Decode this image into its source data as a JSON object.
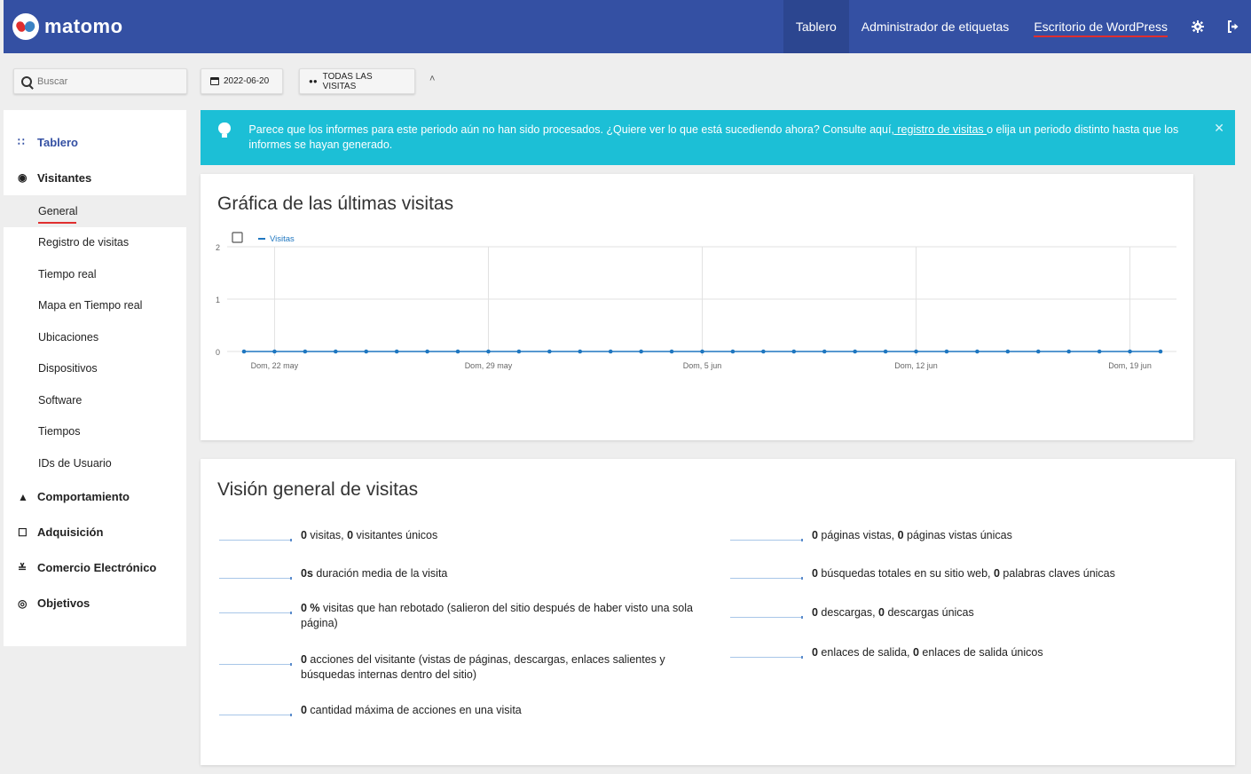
{
  "brand": {
    "name": "matomo"
  },
  "topnav": {
    "items": [
      "Tablero",
      "Administrador de etiquetas",
      "Escritorio de WordPress"
    ],
    "settings_icon": "gear-icon",
    "logout_icon": "sign-out-icon"
  },
  "search": {
    "placeholder": "Buscar"
  },
  "controls": {
    "date": "2022-06-20",
    "segment": "TODAS LAS VISITAS"
  },
  "sidebar": {
    "tablero": "Tablero",
    "visitantes": "Visitantes",
    "visitantes_items": [
      "General",
      "Registro de visitas",
      "Tiempo real",
      "Mapa en Tiempo real",
      "Ubicaciones",
      "Dispositivos",
      "Software",
      "Tiempos",
      "IDs de Usuario"
    ],
    "comportamiento": "Comportamiento",
    "adquisicion": "Adquisición",
    "comercio": "Comercio Electrónico",
    "objetivos": "Objetivos"
  },
  "banner": {
    "text_before": "Parece que los informes para este periodo aún no han sido procesados. ¿Quiere ver lo que está sucediendo ahora? Consulte aquí",
    "link": ", registro de visitas ",
    "text_after": "o elija un periodo distinto hasta que los informes se hayan generado."
  },
  "chart_card": {
    "title": "Gráfica de las últimas visitas"
  },
  "chart_data": {
    "type": "line",
    "title": "Gráfica de las últimas visitas",
    "series": [
      {
        "name": "Visitas",
        "values": [
          0,
          0,
          0,
          0,
          0,
          0,
          0,
          0,
          0,
          0,
          0,
          0,
          0,
          0,
          0,
          0,
          0,
          0,
          0,
          0,
          0,
          0,
          0,
          0,
          0,
          0,
          0,
          0,
          0,
          0,
          0
        ]
      }
    ],
    "x_start": "2022-05-21",
    "x_end": "2022-06-20",
    "x_tick_labels": [
      "Dom, 22 may",
      "Dom, 29 may",
      "Dom, 5 jun",
      "Dom, 12 jun",
      "Dom, 19 jun"
    ],
    "y_ticks": [
      0,
      1,
      2
    ],
    "ylim": [
      0,
      2
    ],
    "grid": true,
    "color": "#1f77c0"
  },
  "overview": {
    "title": "Visión general de visitas",
    "left": [
      {
        "bold": "0",
        "text": " visitas, ",
        "bold2": "0",
        "text2": " visitantes únicos"
      },
      {
        "bold": "0s",
        "text": " duración media de la visita",
        "bold2": "",
        "text2": ""
      },
      {
        "bold": "0 %",
        "text": " visitas que han rebotado (salieron del sitio después de haber visto una sola página)",
        "bold2": "",
        "text2": ""
      },
      {
        "bold": "0",
        "text": " acciones del visitante (vistas de páginas, descargas, enlaces salientes y búsquedas internas dentro del sitio)",
        "bold2": "",
        "text2": ""
      },
      {
        "bold": "0",
        "text": " cantidad máxima de acciones en una visita",
        "bold2": "",
        "text2": ""
      }
    ],
    "right": [
      {
        "bold": "0",
        "text": " páginas vistas, ",
        "bold2": "0",
        "text2": " páginas vistas únicas"
      },
      {
        "bold": "0",
        "text": " búsquedas totales en su sitio web, ",
        "bold2": "0",
        "text2": " palabras claves únicas"
      },
      {
        "bold": "0",
        "text": " descargas, ",
        "bold2": "0",
        "text2": " descargas únicas"
      },
      {
        "bold": "0",
        "text": " enlaces de salida, ",
        "bold2": "0",
        "text2": " enlaces de salida únicos"
      }
    ]
  }
}
